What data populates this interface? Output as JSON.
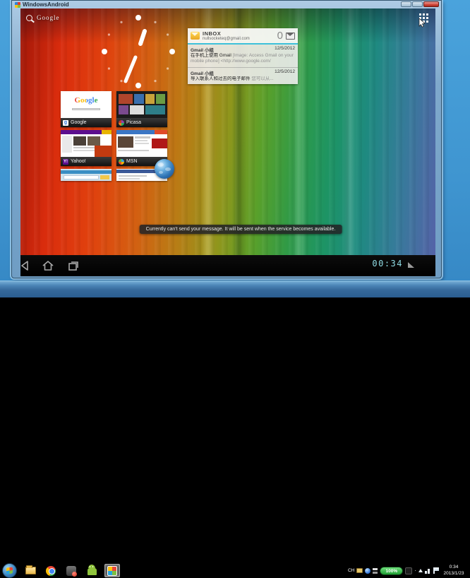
{
  "window": {
    "title": "WindowsAndroid"
  },
  "android": {
    "search_label": "Google",
    "inbox": {
      "title": "INBOX",
      "account": "nullsocketeq@gmail.com",
      "count": "0",
      "emails": [
        {
          "sender": "Gmail 小组",
          "date": "12/5/2012",
          "subject": "在手机上使用 Gmail",
          "snippet": "[Image: Access Gmail on your mobile phone] <http://www.google.com/"
        },
        {
          "sender": "Gmail 小组",
          "date": "12/5/2012",
          "subject": "导入联系人和过去的电子邮件",
          "snippet": "您可以从..."
        }
      ]
    },
    "bookmarks": {
      "items": [
        {
          "label": "Google"
        },
        {
          "label": "Picasa"
        },
        {
          "label": "Yahoo!"
        },
        {
          "label": "MSN"
        }
      ],
      "google_thumb_text": "Google"
    },
    "toast": "Currently can't send your message. It will be sent when the service becomes available.",
    "navbar": {
      "clock": "00:34"
    }
  },
  "taskbar": {
    "language": "CH",
    "battery": "100%",
    "time": "0:34",
    "date": "2013/1/23"
  },
  "icons": {
    "search": "magnifier",
    "all_apps": "grid-of-dots",
    "inbox_widget": "yellow-envelope",
    "compose": "envelope-with-pen",
    "nav_back": "back-triangle",
    "nav_home": "house-outline",
    "nav_recents": "stacked-windows",
    "signal": "triangle-wedge",
    "browser": "globe"
  },
  "colors": {
    "holo_accent": "#3ec1da",
    "navbar_clock": "#8fdbe3",
    "battery_green": "#1f9e33",
    "desktop_blue": "#4aa3dc",
    "close_button_red": "#cf4437"
  }
}
